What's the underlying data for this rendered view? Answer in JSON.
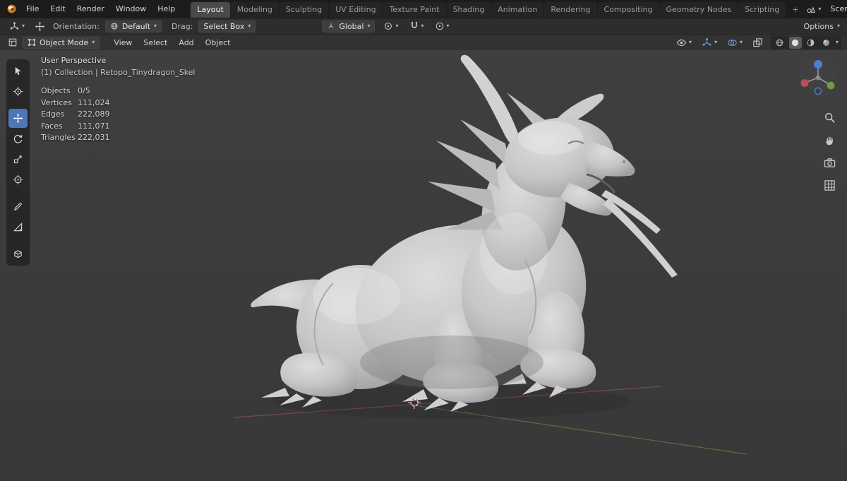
{
  "topbar": {
    "menus": [
      "File",
      "Edit",
      "Render",
      "Window",
      "Help"
    ],
    "tabs": [
      {
        "label": "Layout",
        "active": true
      },
      {
        "label": "Modeling"
      },
      {
        "label": "Sculpting"
      },
      {
        "label": "UV Editing"
      },
      {
        "label": "Texture Paint"
      },
      {
        "label": "Shading"
      },
      {
        "label": "Animation"
      },
      {
        "label": "Rendering"
      },
      {
        "label": "Compositing"
      },
      {
        "label": "Geometry Nodes"
      },
      {
        "label": "Scripting"
      }
    ],
    "add_tab_label": "+",
    "scene_label": "Scene"
  },
  "tool_settings": {
    "orientation_label": "Orientation:",
    "orientation_value": "Default",
    "drag_label": "Drag:",
    "drag_value": "Select Box",
    "transform_space": "Global",
    "options_label": "Options"
  },
  "viewport_header": {
    "mode": "Object Mode",
    "menus": [
      "View",
      "Select",
      "Add",
      "Object"
    ]
  },
  "viewport_overlay": {
    "perspective": "User Perspective",
    "collection": "(1) Collection | Retopo_Tinydragon_Skel",
    "stats": [
      {
        "label": "Objects",
        "value": "0/5"
      },
      {
        "label": "Vertices",
        "value": "111,024"
      },
      {
        "label": "Edges",
        "value": "222,089"
      },
      {
        "label": "Faces",
        "value": "111,071"
      },
      {
        "label": "Triangles",
        "value": "222,031"
      }
    ]
  },
  "tools": [
    "select-box",
    "cursor",
    "move",
    "rotate",
    "scale",
    "transform",
    "annotate",
    "measure",
    "add-cube"
  ],
  "active_tool": "move",
  "colors": {
    "accent": "#4f76b8",
    "axis_x": "#b3535e",
    "axis_y": "#7d9a48",
    "axis_z": "#4a7fd6",
    "viewport_bg": "#3c3c3c",
    "model_gray": "#c6c6c6"
  }
}
